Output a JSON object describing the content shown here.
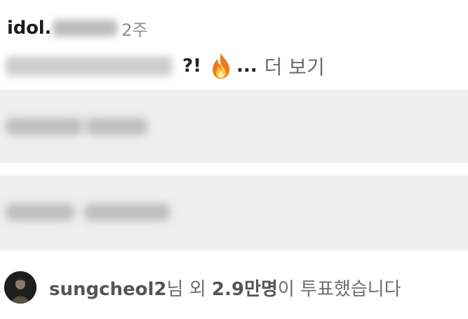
{
  "post": {
    "username_visible": "idol.",
    "time": "2주"
  },
  "caption": {
    "punctuation": "?!",
    "emoji": "fire-emoji",
    "ellipsis": "...",
    "more_label": "더 보기"
  },
  "poll": {
    "options_count": 2
  },
  "voters": {
    "user": "sungcheol2",
    "suffix_1": "님 외 ",
    "count": "2.9만명",
    "suffix_2": "이 투표했습니다"
  },
  "colors": {
    "option_background": "#efefef",
    "muted_text": "#8e8e8e",
    "fire_orange": "#f07a1a"
  }
}
